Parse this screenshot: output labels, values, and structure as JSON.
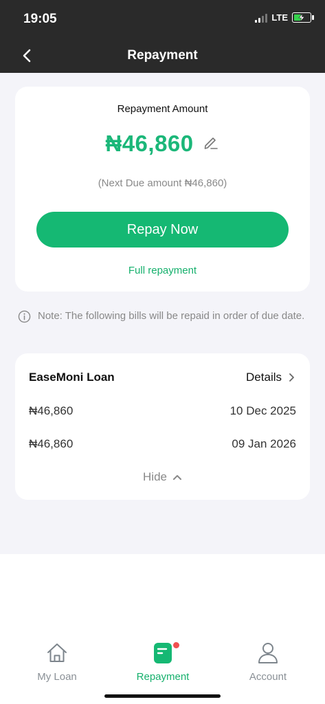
{
  "status_bar": {
    "time": "19:05",
    "network": "LTE",
    "battery_color": "#35d24c"
  },
  "header": {
    "title": "Repayment",
    "back_icon": "chevron-left-icon"
  },
  "repayment_card": {
    "label": "Repayment Amount",
    "amount": "₦46,860",
    "edit_icon": "pencil-icon",
    "next_due": "(Next Due amount ₦46,860)",
    "repay_button": "Repay Now",
    "full_repayment_link": "Full repayment"
  },
  "note": {
    "icon": "info-icon",
    "text": "Note: The following bills will be repaid in order of due date."
  },
  "loan_card": {
    "name": "EaseMoni Loan",
    "details_label": "Details",
    "bills": [
      {
        "amount": "₦46,860",
        "date": "10 Dec 2025"
      },
      {
        "amount": "₦46,860",
        "date": "09 Jan 2026"
      }
    ],
    "hide_label": "Hide"
  },
  "tab_bar": {
    "tabs": [
      {
        "label": "My Loan",
        "icon": "home-icon",
        "active": false
      },
      {
        "label": "Repayment",
        "icon": "repayment-icon",
        "active": true
      },
      {
        "label": "Account",
        "icon": "user-icon",
        "active": false
      }
    ]
  },
  "colors": {
    "accent": "#15b873",
    "header_bg": "#2a2a2a",
    "page_bg": "#f4f4f9",
    "badge": "#f15050"
  }
}
